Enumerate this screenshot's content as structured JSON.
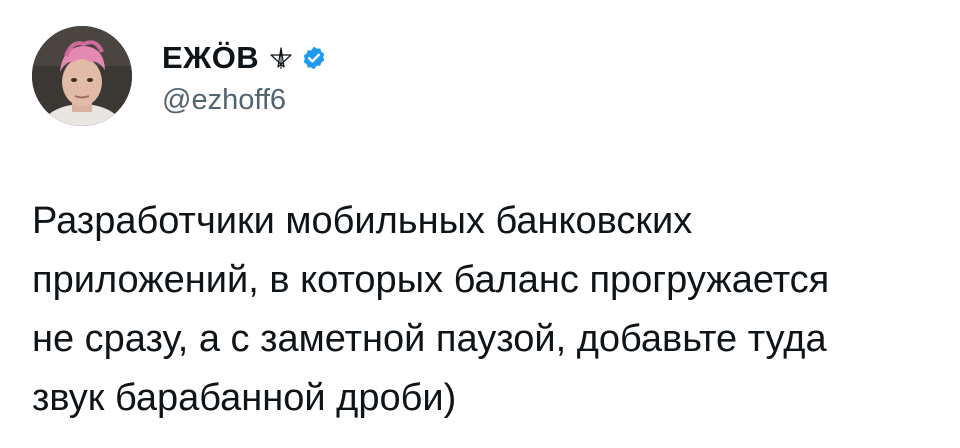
{
  "author": {
    "display_name": "ЕЖÖВ",
    "handle": "@ezhoff6",
    "avatar_icon": "profile-photo",
    "badge_icon": "pentagram-icon",
    "verified_icon": "verified-badge-icon",
    "verified_color": "#1d9bf0"
  },
  "tweet": {
    "text": "Разработчики мобильных банковских\nприложений, в которых баланс прогружается\nне сразу, а с заметной паузой, добавьте туда\nзвук барабанной дроби)"
  },
  "colors": {
    "text": "#0f1419",
    "secondary_text": "#536471",
    "background": "#ffffff"
  }
}
